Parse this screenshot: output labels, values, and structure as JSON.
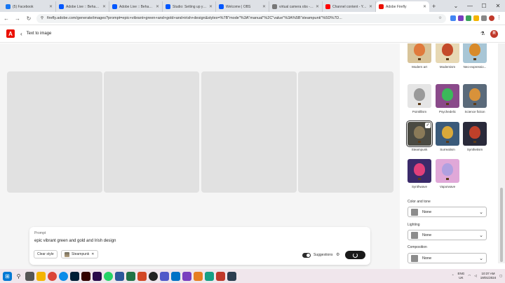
{
  "tabs": [
    {
      "label": "(5) Facebook",
      "color": "#1877f2"
    },
    {
      "label": "Adobe Live :: Behance",
      "color": "#0057ff"
    },
    {
      "label": "Adobe Live :: Behance",
      "color": "#0057ff"
    },
    {
      "label": "Studio: Setting up your s...",
      "color": "#0057ff"
    },
    {
      "label": "Welcome | OBS",
      "color": "#0057ff"
    },
    {
      "label": "virtual camera obs - G...",
      "color": "#777777"
    },
    {
      "label": "Channel content - YouT...",
      "color": "#ff0000"
    },
    {
      "label": "Adobe Firefly",
      "color": "#eb1000"
    }
  ],
  "address": {
    "url": "firefly.adobe.com/generate/images?prompt=epic+vibrant+green+and+gold+and+irish+design&styles=%7B\"mode\"%3A\"manual\"%2C\"value\"%3A%5B\"steampunk\"%5D%7D..."
  },
  "app": {
    "logo": "A",
    "title": "Text to image",
    "avatar": "R"
  },
  "prompt": {
    "label": "Prompt",
    "text": "epic vibrant green and gold and Irish design",
    "clear_style": "Clear style",
    "style_chip": "Steampunk",
    "suggestions": "Suggestions"
  },
  "styles": [
    {
      "label": "Modern art",
      "color": "#e07a3c",
      "bg": "#d8c49a"
    },
    {
      "label": "Modernism",
      "color": "#c44a2a",
      "bg": "#e7d8b4"
    },
    {
      "label": "Neo-expressio...",
      "color": "#d88a2a",
      "bg": "#a8c6d6"
    },
    {
      "label": "Pointillism",
      "color": "#9a9a9a",
      "bg": "#e5e5e5"
    },
    {
      "label": "Psychedelic",
      "color": "#3bb85a",
      "bg": "#8a4a8a"
    },
    {
      "label": "Science fiction",
      "color": "#d8923a",
      "bg": "#5a6a7a"
    },
    {
      "label": "Steampunk",
      "color": "#8a7a58",
      "bg": "#4a4a42",
      "selected": true
    },
    {
      "label": "Surrealism",
      "color": "#d8a83a",
      "bg": "#3a5a7a"
    },
    {
      "label": "Synthetism",
      "color": "#c0402a",
      "bg": "#2a2a3a"
    },
    {
      "label": "Synthwave",
      "color": "#e0407a",
      "bg": "#3a2a6a"
    },
    {
      "label": "Vaporwave",
      "color": "#b0a0e0",
      "bg": "#e0a8d8"
    }
  ],
  "settings": {
    "color_tone": {
      "label": "Color and tone",
      "value": "None"
    },
    "lighting": {
      "label": "Lighting",
      "value": "None"
    },
    "composition": {
      "label": "Composition",
      "value": "None"
    }
  },
  "clock": {
    "time": "10:37 AM",
    "date": "19/01/2024",
    "lang": "ENG",
    "region": "UK"
  }
}
